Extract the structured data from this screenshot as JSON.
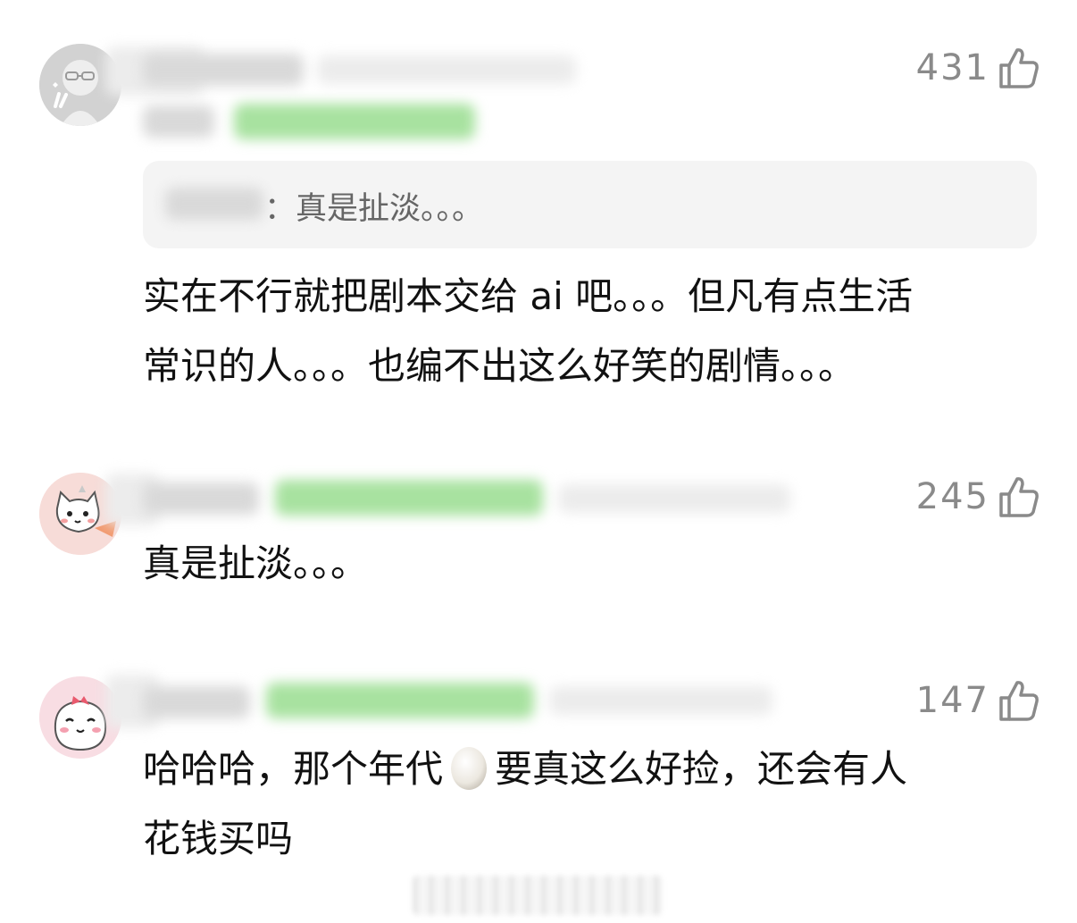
{
  "comments": [
    {
      "likes": "431",
      "quote_separator": "：",
      "quoted_text": "真是扯淡。。。",
      "text_lines": [
        "实在不行就把剧本交给 ai 吧。。。但凡有点生活",
        "常识的人。。。也编不出这么好笑的剧情。。。"
      ]
    },
    {
      "likes": "245",
      "text_lines": [
        "真是扯淡。。。"
      ]
    },
    {
      "likes": "147",
      "text_before_emoji": "哈哈哈，那个年代",
      "emoji": "egg",
      "text_after_emoji": "要真这么好捡，还会有人",
      "text_line2": "花钱买吗"
    }
  ],
  "icons": {
    "like": "thumbs-up-icon",
    "emoji": "egg-icon"
  },
  "colors": {
    "like_count": "#8a8a8a",
    "reply_bg": "#f4f4f4",
    "badge_green": "#a8e2a0"
  }
}
